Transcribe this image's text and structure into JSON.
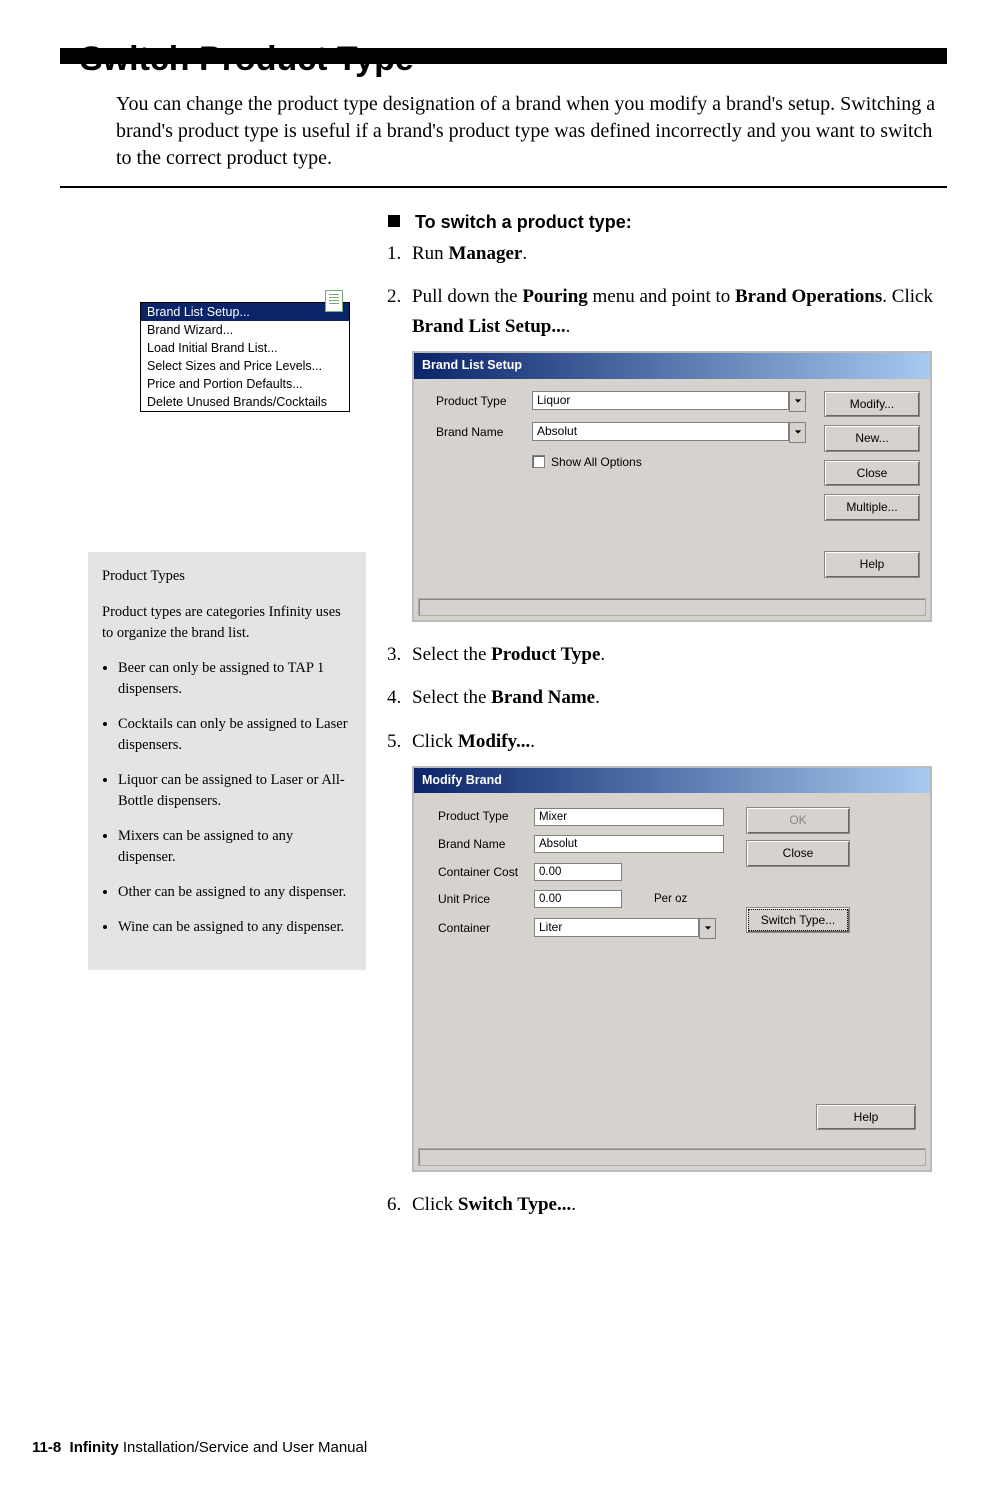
{
  "page": {
    "title": "Switch Product Type",
    "intro": "You can change the product type designation of a brand when you modify a brand's setup. Switching a brand's product type is useful if a brand's product type was defined incorrectly and you want to switch to the correct product type.",
    "footer_pagenum": "11-8",
    "footer_product": "Infinity",
    "footer_manual": " Installation/Service and User Manual"
  },
  "menu": {
    "items": [
      "Brand List Setup...",
      "Brand Wizard...",
      "Load Initial Brand List...",
      "Select Sizes and Price Levels...",
      "Price and Portion Defaults...",
      "Delete Unused Brands/Cocktails"
    ]
  },
  "sidebar": {
    "title": "Product Types",
    "desc": "Product types are categories Infinity uses to organize the brand list.",
    "bullets": [
      "Beer can only be assigned to TAP 1 dispensers.",
      "Cocktails can only be assigned to Laser dispensers.",
      "Liquor can be assigned to Laser or All-Bottle dispensers.",
      "Mixers can be assigned to any dispenser.",
      "Other can be assigned to any dispenser.",
      "Wine can be assigned to any dispenser."
    ]
  },
  "proc": {
    "heading": "To switch a product type:",
    "step1_pre": "Run ",
    "step1_b": "Manager",
    "step1_post": ".",
    "step2_a": "Pull down the ",
    "step2_b1": "Pouring",
    "step2_c": " menu and point to ",
    "step2_b2": "Brand Operations",
    "step2_d": ". Click ",
    "step2_b3": "Brand List Setup...",
    "step2_e": ".",
    "step3_a": "Select the ",
    "step3_b": "Product Type",
    "step3_c": ".",
    "step4_a": "Select the ",
    "step4_b": "Brand Name",
    "step4_c": ".",
    "step5_a": "Click ",
    "step5_b": "Modify...",
    "step5_c": ".",
    "step6_a": "Click ",
    "step6_b": "Switch Type...",
    "step6_c": "."
  },
  "dlg1": {
    "title": "Brand List Setup",
    "labels": {
      "product_type": "Product Type",
      "brand_name": "Brand Name"
    },
    "values": {
      "product_type": "Liquor",
      "brand_name": "Absolut"
    },
    "checkbox": "Show All Options",
    "buttons": {
      "modify": "Modify...",
      "new": "New...",
      "close": "Close",
      "multiple": "Multiple...",
      "help": "Help"
    }
  },
  "dlg2": {
    "title": "Modify Brand",
    "labels": {
      "product_type": "Product Type",
      "brand_name": "Brand Name",
      "container_cost": "Container Cost",
      "unit_price": "Unit Price",
      "container": "Container",
      "per_oz": "Per oz"
    },
    "values": {
      "product_type": "Mixer",
      "brand_name": "Absolut",
      "container_cost": "0.00",
      "unit_price": "0.00",
      "container": "Liter"
    },
    "buttons": {
      "ok": "OK",
      "close": "Close",
      "switch": "Switch Type...",
      "help": "Help"
    }
  }
}
